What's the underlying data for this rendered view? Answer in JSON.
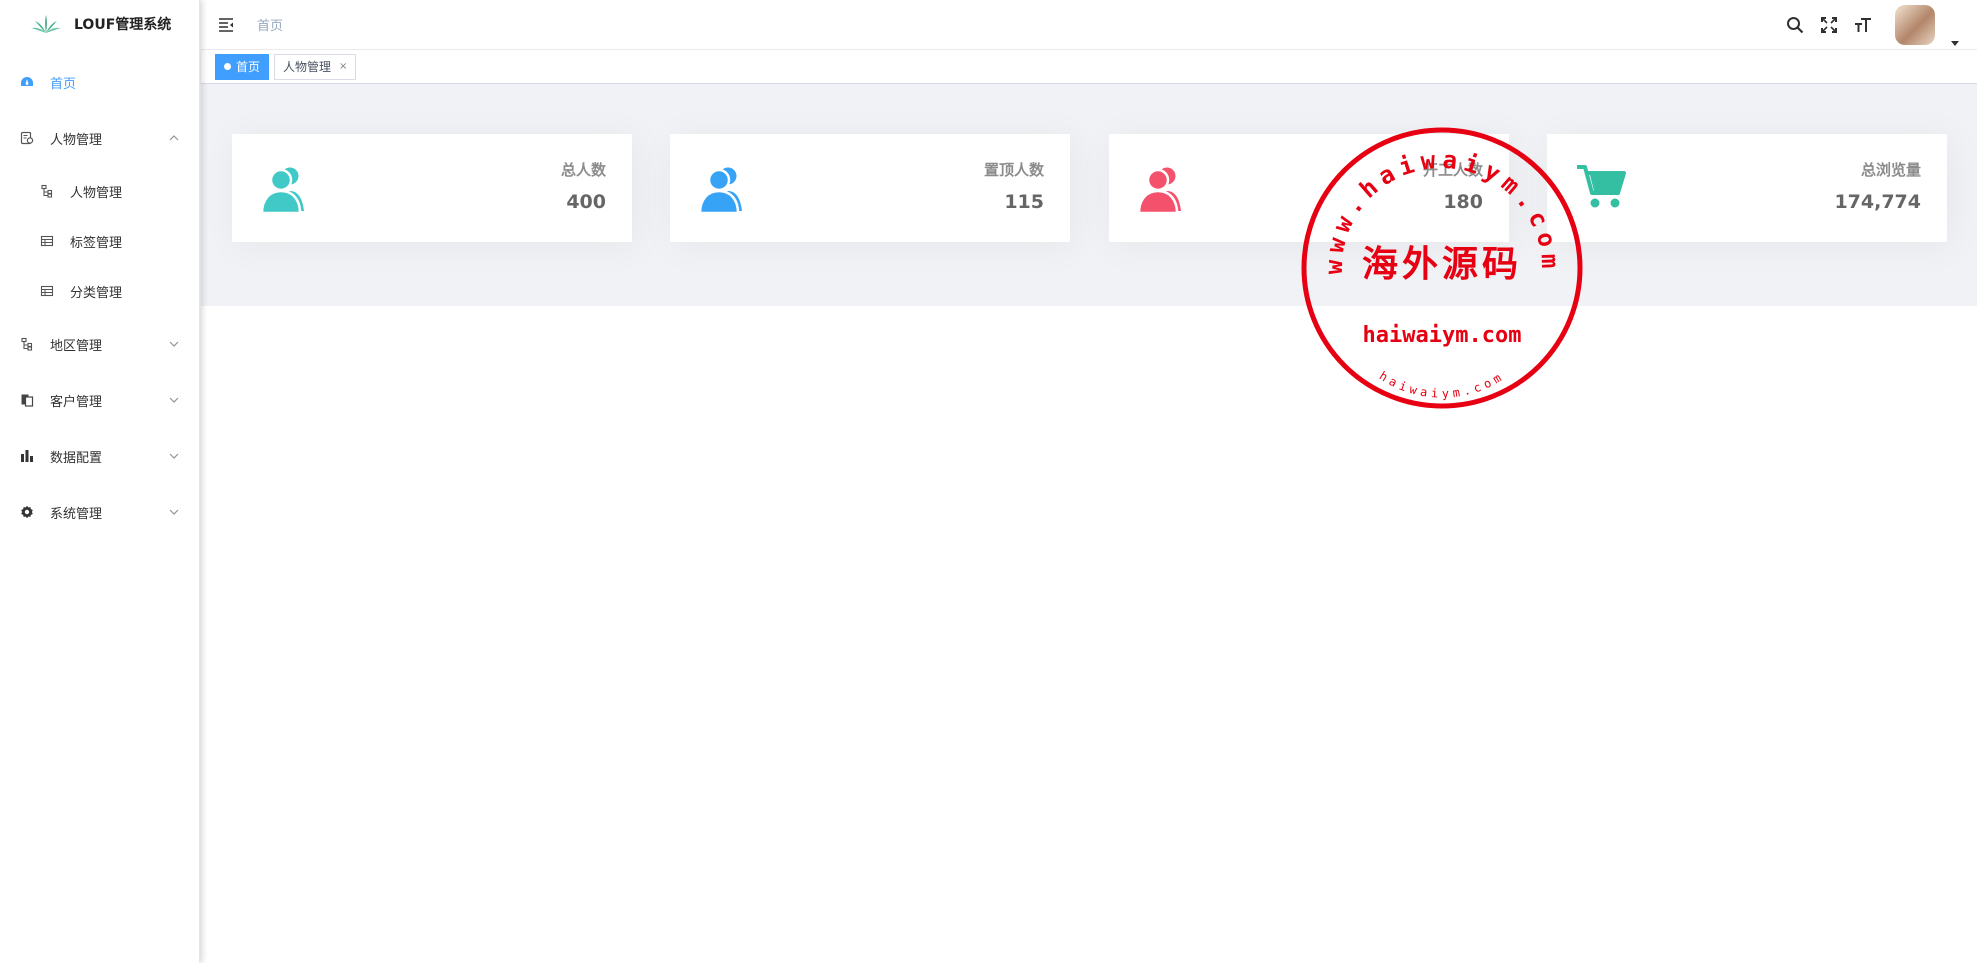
{
  "app": {
    "title": "LOUF管理系统"
  },
  "sidebar": {
    "items": [
      {
        "label": "首页",
        "icon": "dashboard-icon",
        "active": true
      },
      {
        "label": "人物管理",
        "icon": "people-manage-icon",
        "expanded": true,
        "children": [
          {
            "label": "人物管理",
            "icon": "tree-icon"
          },
          {
            "label": "标签管理",
            "icon": "table-icon"
          },
          {
            "label": "分类管理",
            "icon": "table-icon"
          }
        ]
      },
      {
        "label": "地区管理",
        "icon": "tree-icon"
      },
      {
        "label": "客户管理",
        "icon": "documents-icon"
      },
      {
        "label": "数据配置",
        "icon": "bar-chart-icon"
      },
      {
        "label": "系统管理",
        "icon": "gear-icon"
      }
    ]
  },
  "navbar": {
    "breadcrumb": "首页",
    "icons": [
      "search-icon",
      "fullscreen-icon",
      "font-size-icon"
    ]
  },
  "tags": [
    {
      "label": "首页",
      "active": true
    },
    {
      "label": "人物管理",
      "active": false,
      "close": "×"
    }
  ],
  "panels": [
    {
      "label": "总人数",
      "value": "400",
      "color": "#40c9c6",
      "icon": "people-icon"
    },
    {
      "label": "置顶人数",
      "value": "115",
      "color": "#36a3f7",
      "icon": "people-icon"
    },
    {
      "label": "开工人数",
      "value": "180",
      "color": "#f4516c",
      "icon": "people-icon"
    },
    {
      "label": "总浏览量",
      "value": "174,774",
      "color": "#34bfa3",
      "icon": "shopping-cart-icon"
    }
  ],
  "stamp": {
    "top_arc": "www.haiwaiym.com",
    "center": "海外源码",
    "middle": "haiwaiym.com",
    "bottom_arc": "haiwaiym.com",
    "color": "#e60012"
  }
}
